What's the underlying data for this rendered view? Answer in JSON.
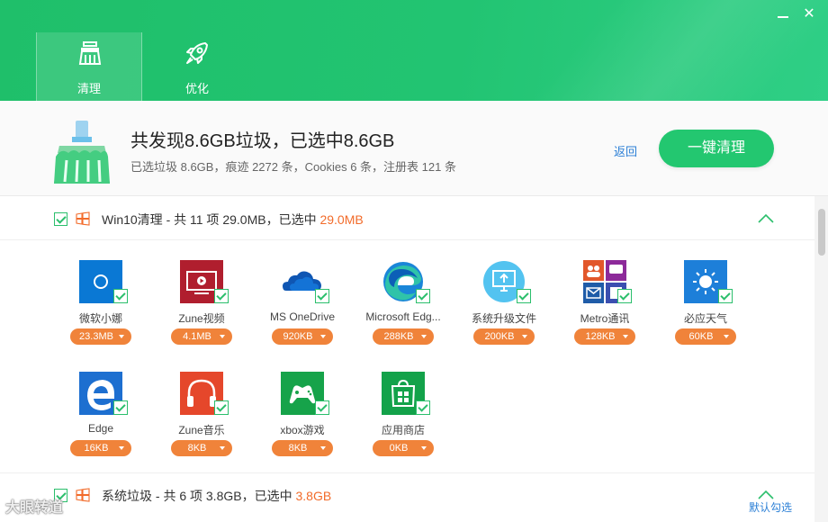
{
  "window": {
    "minimize": "",
    "close": "✕"
  },
  "tabs": [
    {
      "label": "清理",
      "active": true
    },
    {
      "label": "优化",
      "active": false
    }
  ],
  "summary": {
    "title": "共发现8.6GB垃圾，已选中8.6GB",
    "subtitle": "已选垃圾 8.6GB，痕迹 2272 条，Cookies 6 条，注册表 121 条",
    "back": "返回",
    "clean_button": "一键清理"
  },
  "sections": [
    {
      "prefix": "Win10清理 - 共 11 项 29.0MB，已选中 ",
      "selected": "29.0MB"
    },
    {
      "prefix": "系统垃圾 - 共 6 项 3.8GB，已选中 ",
      "selected": "3.8GB"
    }
  ],
  "items": [
    {
      "name": "微软小娜",
      "size": "23.3MB",
      "icon": "cortana-icon"
    },
    {
      "name": "Zune视频",
      "size": "4.1MB",
      "icon": "zune-video-icon"
    },
    {
      "name": "MS OneDrive",
      "size": "920KB",
      "icon": "onedrive-icon"
    },
    {
      "name": "Microsoft Edg...",
      "size": "288KB",
      "icon": "edge-new-icon"
    },
    {
      "name": "系统升级文件",
      "size": "200KB",
      "icon": "system-upgrade-icon"
    },
    {
      "name": "Metro通讯",
      "size": "128KB",
      "icon": "metro-people-icon"
    },
    {
      "name": "必应天气",
      "size": "60KB",
      "icon": "bing-weather-icon"
    },
    {
      "name": "Edge",
      "size": "16KB",
      "icon": "edge-legacy-icon"
    },
    {
      "name": "Zune音乐",
      "size": "8KB",
      "icon": "zune-music-icon"
    },
    {
      "name": "xbox游戏",
      "size": "8KB",
      "icon": "xbox-icon"
    },
    {
      "name": "应用商店",
      "size": "0KB",
      "icon": "store-icon"
    }
  ],
  "footer": {
    "default_select": "默认勾选",
    "watermark": "大眼转道"
  },
  "colors": {
    "accent": "#23c770",
    "size_badge": "#f0833a",
    "highlight": "#f26b2a",
    "link": "#2b7fd6"
  }
}
